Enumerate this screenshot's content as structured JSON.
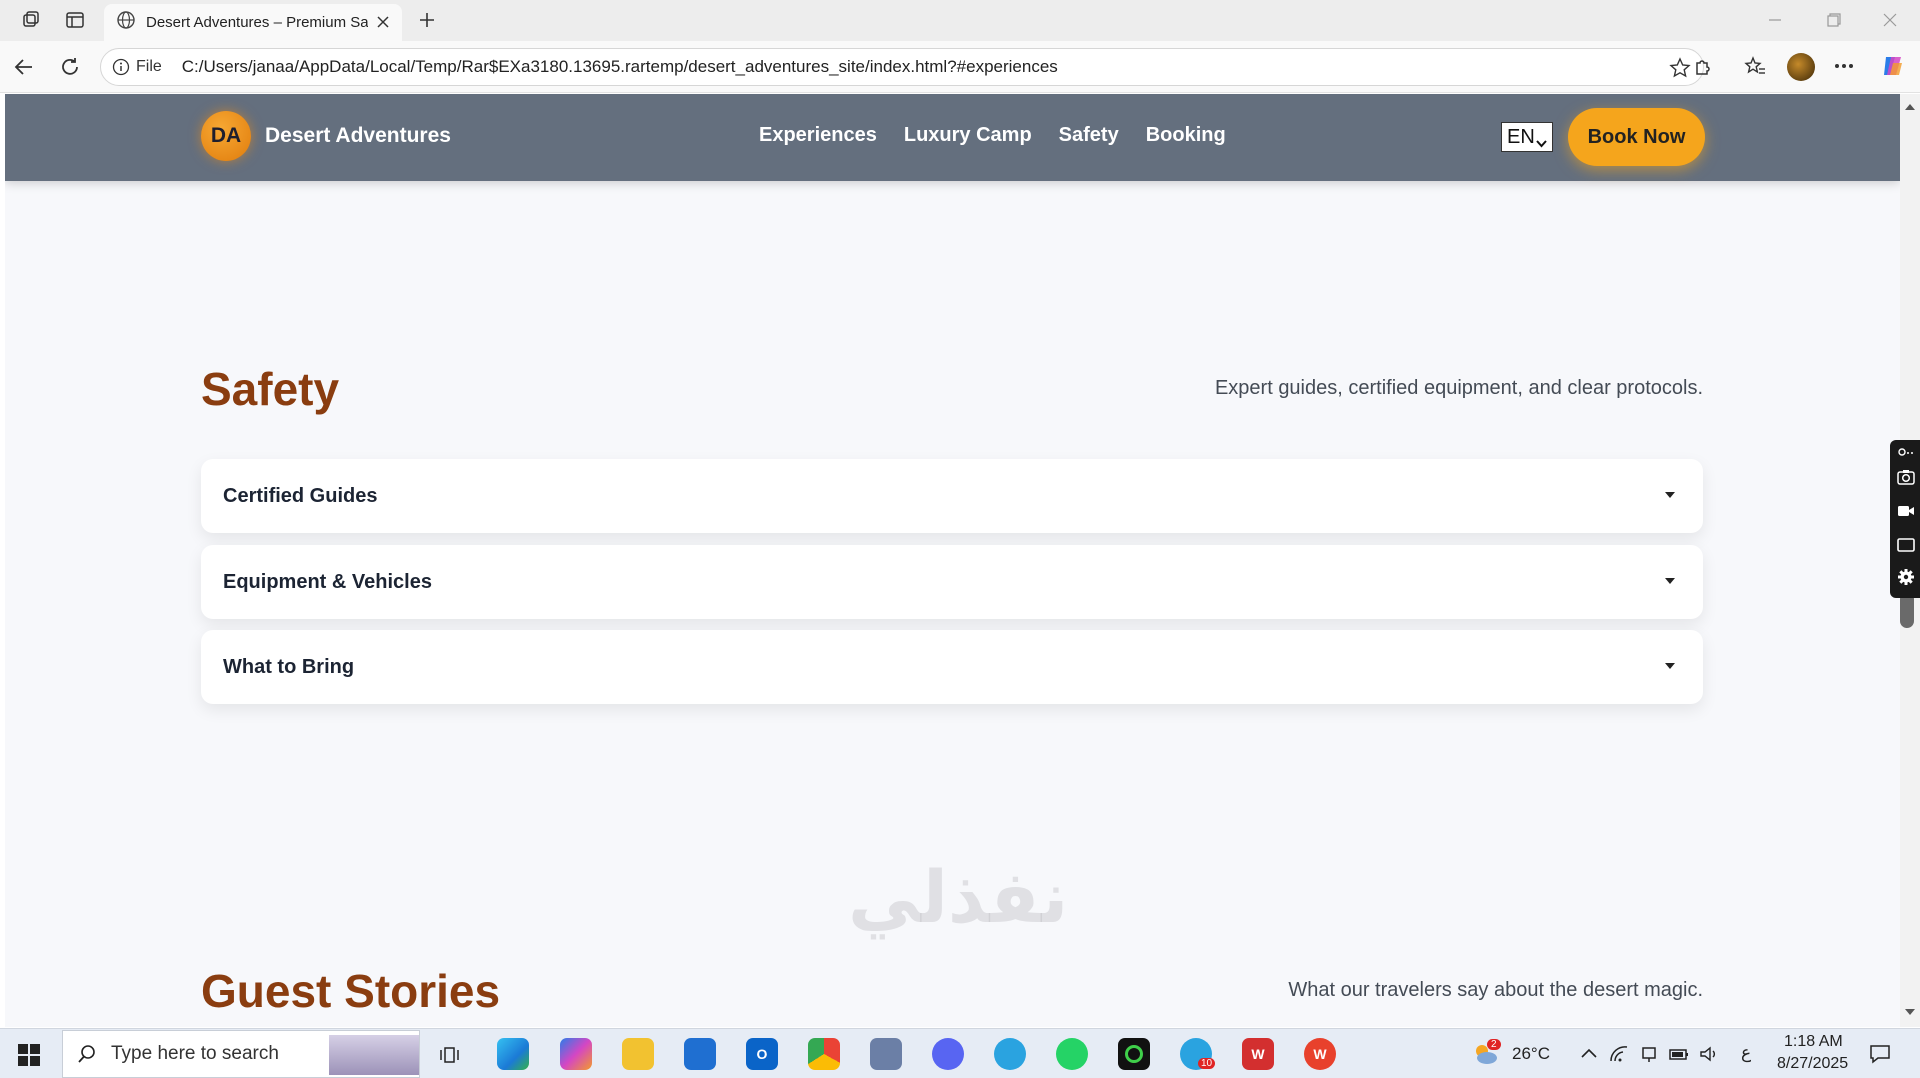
{
  "browser": {
    "tab_title": "Desert Adventures – Premium Safari",
    "file_label": "File",
    "url": "C:/Users/janaa/AppData/Local/Temp/Rar$EXa3180.13695.rartemp/desert_adventures_site/index.html?#experiences"
  },
  "site": {
    "logo": "DA",
    "brand": "Desert Adventures",
    "nav": [
      "Experiences",
      "Luxury Camp",
      "Safety",
      "Booking"
    ],
    "lang": "EN",
    "book_label": "Book Now"
  },
  "safety": {
    "title": "Safety",
    "subtitle": "Expert guides, certified equipment, and clear protocols.",
    "items": [
      "Certified Guides",
      "Equipment & Vehicles",
      "What to Bring"
    ]
  },
  "stories": {
    "title": "Guest Stories",
    "subtitle": "What our travelers say about the desert magic."
  },
  "watermark": "نفذلي",
  "taskbar": {
    "search_placeholder": "Type here to search",
    "weather": "26°C",
    "weather_badge": "2",
    "telegram_badge": "10",
    "lang_indicator": "ع",
    "time": "1:18 AM",
    "date": "8/27/2025"
  },
  "colors": {
    "accent": "#f5a51c",
    "heading": "#8a3d10",
    "navbar": "#646f7e"
  }
}
